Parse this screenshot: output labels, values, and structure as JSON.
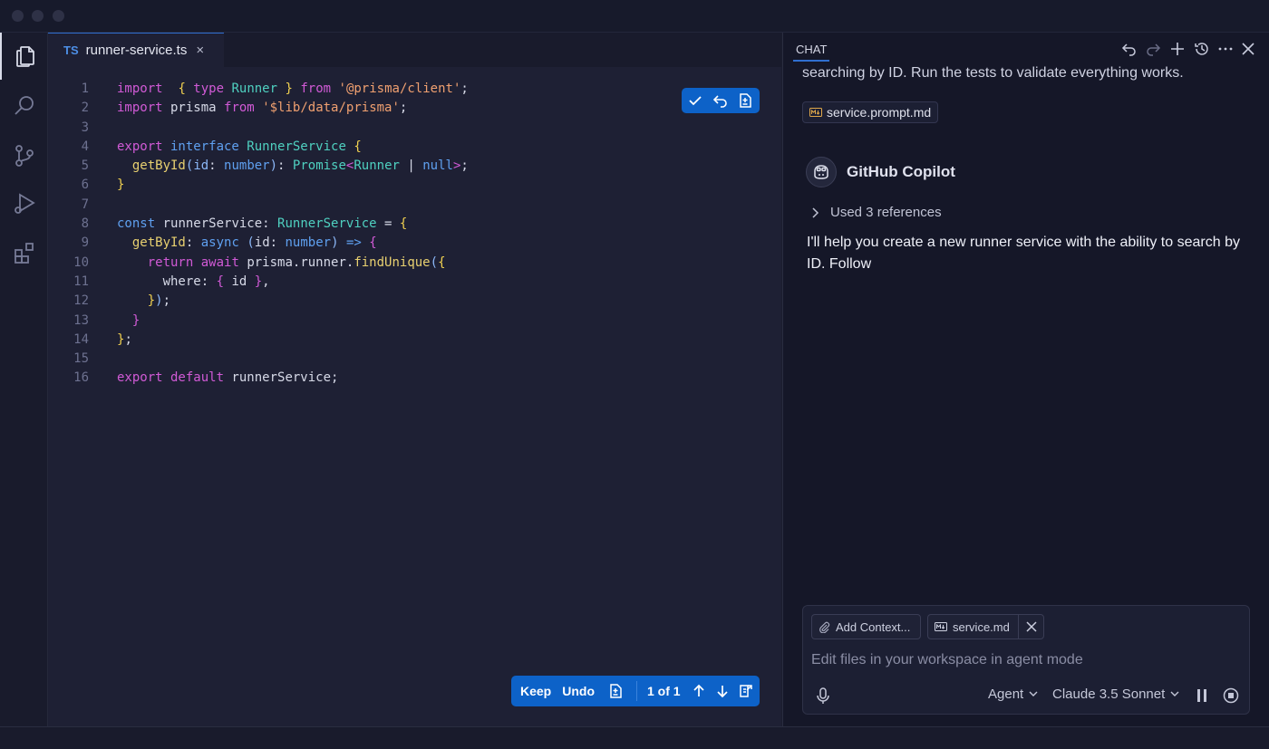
{
  "editor": {
    "tab": {
      "lang_badge": "TS",
      "filename": "runner-service.ts",
      "close_glyph": "×"
    },
    "line_numbers": [
      "1",
      "2",
      "3",
      "4",
      "5",
      "6",
      "7",
      "8",
      "9",
      "10",
      "11",
      "12",
      "13",
      "14",
      "15",
      "16"
    ],
    "lines": [
      [
        [
          "k",
          "import"
        ],
        [
          "",
          "  "
        ],
        [
          "yb",
          "{"
        ],
        [
          "",
          ""
        ],
        [
          "k",
          " type"
        ],
        [
          "ty",
          " Runner"
        ],
        [
          "",
          " "
        ],
        [
          "yb",
          "}"
        ],
        [
          "k",
          " from"
        ],
        [
          "",
          " "
        ],
        [
          "st",
          "'@prisma/client'"
        ],
        [
          "",
          ";"
        ]
      ],
      [
        [
          "k",
          "import"
        ],
        [
          "",
          " prisma"
        ],
        [
          "k",
          " from"
        ],
        [
          "",
          " "
        ],
        [
          "st",
          "'$lib/data/prisma'"
        ],
        [
          "",
          ";"
        ]
      ],
      [],
      [
        [
          "k",
          "export"
        ],
        [
          "bl",
          " interface"
        ],
        [
          "ty",
          " RunnerService"
        ],
        [
          "",
          " "
        ],
        [
          "yb",
          "{"
        ]
      ],
      [
        [
          "",
          "  "
        ],
        [
          "fn",
          "getById"
        ],
        [
          "pr",
          "("
        ],
        [
          "",
          ""
        ],
        [
          "pr",
          "id"
        ],
        [
          "",
          ": "
        ],
        [
          "bl",
          "number"
        ],
        [
          "pr",
          ")"
        ],
        [
          "",
          ": "
        ],
        [
          "ty",
          "Promise"
        ],
        [
          "op",
          "<"
        ],
        [
          "ty",
          "Runner"
        ],
        [
          "",
          " | "
        ],
        [
          "bl",
          "null"
        ],
        [
          "op",
          ">"
        ],
        [
          "",
          ";"
        ]
      ],
      [
        [
          "yb",
          "}"
        ]
      ],
      [],
      [
        [
          "bl",
          "const"
        ],
        [
          "",
          " runnerService"
        ],
        [
          "",
          ": "
        ],
        [
          "ty",
          "RunnerService"
        ],
        [
          "",
          " = "
        ],
        [
          "yb",
          "{"
        ]
      ],
      [
        [
          "",
          "  "
        ],
        [
          "fn",
          "getById"
        ],
        [
          "",
          ": "
        ],
        [
          "bl",
          "async"
        ],
        [
          "",
          " "
        ],
        [
          "pr",
          "("
        ],
        [
          "",
          "id"
        ],
        [
          "",
          ": "
        ],
        [
          "bl",
          "number"
        ],
        [
          "pr",
          ")"
        ],
        [
          "",
          " "
        ],
        [
          "bl",
          "=>"
        ],
        [
          "",
          " "
        ],
        [
          "k",
          "{"
        ]
      ],
      [
        [
          "",
          "    "
        ],
        [
          "k",
          "return"
        ],
        [
          "",
          " "
        ],
        [
          "k",
          "await"
        ],
        [
          "",
          " prisma.runner."
        ],
        [
          "fn",
          "findUnique"
        ],
        [
          "pr",
          "("
        ],
        [
          "yb",
          "{"
        ]
      ],
      [
        [
          "",
          "      where: "
        ],
        [
          "k",
          "{"
        ],
        [
          "",
          " id "
        ],
        [
          "k",
          "}"
        ],
        [
          "",
          ","
        ]
      ],
      [
        [
          "",
          "    "
        ],
        [
          "yb",
          "}"
        ],
        [
          "pr",
          ")"
        ],
        [
          "",
          ";"
        ]
      ],
      [
        [
          "",
          "  "
        ],
        [
          "k",
          "}"
        ]
      ],
      [
        [
          "yb",
          "}"
        ],
        [
          "",
          ";"
        ]
      ],
      [],
      [
        [
          "k",
          "export"
        ],
        [
          "k",
          " default"
        ],
        [
          "",
          " runnerService;"
        ]
      ]
    ],
    "hunk_toolbar": {
      "icons": [
        "check-icon",
        "undo-icon",
        "diff-file-icon"
      ]
    },
    "review_bar": {
      "keep_label": "Keep",
      "undo_label": "Undo",
      "counter": "1 of 1"
    }
  },
  "chat": {
    "title": "CHAT",
    "intro_text": "searching by ID. Run the tests to validate everything works.",
    "attached_file": "service.prompt.md",
    "assistant_name": "GitHub Copilot",
    "references_label": "Used 3 references",
    "answer_text": "I'll help you create a new runner service with the ability to search by ID. Follow",
    "input": {
      "add_context_label": "Add Context...",
      "context_file": "service.md",
      "placeholder": "Edit files in your workspace in agent mode",
      "mode_label": "Agent",
      "model_label": "Claude 3.5 Sonnet"
    }
  },
  "colors": {
    "accent": "#0d62c8",
    "background": "#1e2034",
    "chat_background": "#151728"
  }
}
